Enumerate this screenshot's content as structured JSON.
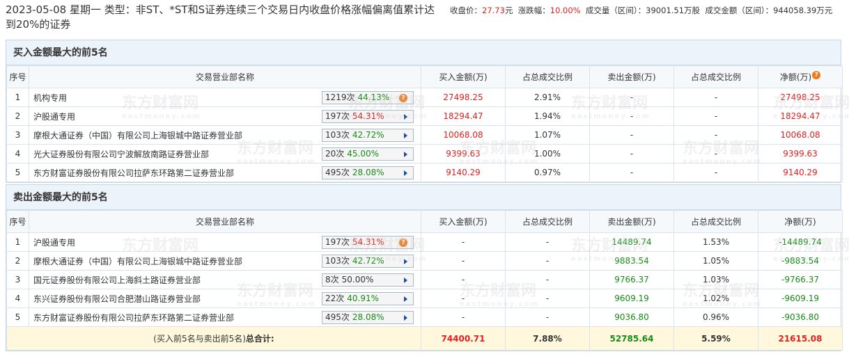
{
  "header": {
    "title": "2023-05-08 星期一 类型：非ST、*ST和S证券连续三个交易日内收盘价格涨幅偏离值累计达到20%的证券",
    "close_label": "收盘价：",
    "close_value": "27.73",
    "unit_yuan": "元",
    "change_label": "涨跌幅：",
    "change_value": "10.00%",
    "volume_label": "成交量（区间）：",
    "volume_value": "39001.51万股",
    "amount_label": "成交金额（区间）：",
    "amount_value": "944058.39万元"
  },
  "buy_section": {
    "title": "买入金额最大的前5名",
    "columns": [
      "序号",
      "交易营业部名称",
      "买入金额(万)",
      "占总成交比例",
      "卖出金额(万)",
      "占总成交比例",
      "净额(万)"
    ],
    "rows": [
      {
        "idx": "1",
        "name": "机构专用",
        "count": "1219次",
        "pct": "44.13%",
        "pct_color": "green",
        "icon": "question-icon",
        "buy": "27498.25",
        "buy_ratio": "2.91%",
        "sell": "-",
        "sell_ratio": "-",
        "net": "27498.25"
      },
      {
        "idx": "2",
        "name": "沪股通专用",
        "count": "197次",
        "pct": "54.31%",
        "pct_color": "red",
        "icon": "arrow-right-icon",
        "buy": "18294.47",
        "buy_ratio": "1.94%",
        "sell": "-",
        "sell_ratio": "-",
        "net": "18294.47"
      },
      {
        "idx": "3",
        "name": "摩根大通证券（中国）有限公司上海银城中路证券营业部",
        "count": "103次",
        "pct": "42.72%",
        "pct_color": "green",
        "icon": "arrow-right-icon",
        "buy": "10068.08",
        "buy_ratio": "1.07%",
        "sell": "-",
        "sell_ratio": "-",
        "net": "10068.08"
      },
      {
        "idx": "4",
        "name": "光大证券股份有限公司宁波解放南路证券营业部",
        "count": "20次",
        "pct": "45.00%",
        "pct_color": "green",
        "icon": "arrow-right-icon",
        "buy": "9399.63",
        "buy_ratio": "1.00%",
        "sell": "-",
        "sell_ratio": "-",
        "net": "9399.63"
      },
      {
        "idx": "5",
        "name": "东方财富证券股份有限公司拉萨东环路第二证券营业部",
        "count": "495次",
        "pct": "28.08%",
        "pct_color": "green",
        "icon": "arrow-right-icon",
        "buy": "9140.29",
        "buy_ratio": "0.97%",
        "sell": "-",
        "sell_ratio": "-",
        "net": "9140.29"
      }
    ]
  },
  "sell_section": {
    "title": "卖出金额最大的前5名",
    "columns": [
      "序号",
      "交易营业部名称",
      "买入金额(万)",
      "占总成交比例",
      "卖出金额(万)",
      "占总成交比例",
      "净额(万)"
    ],
    "rows": [
      {
        "idx": "1",
        "name": "沪股通专用",
        "count": "197次",
        "pct": "54.31%",
        "pct_color": "red",
        "icon": "question-icon",
        "buy": "-",
        "buy_ratio": "-",
        "sell": "14489.74",
        "sell_ratio": "1.53%",
        "net": "-14489.74"
      },
      {
        "idx": "2",
        "name": "摩根大通证券（中国）有限公司上海银城中路证券营业部",
        "count": "103次",
        "pct": "42.72%",
        "pct_color": "green",
        "icon": "arrow-right-icon",
        "buy": "-",
        "buy_ratio": "-",
        "sell": "9883.54",
        "sell_ratio": "1.05%",
        "net": "-9883.54"
      },
      {
        "idx": "3",
        "name": "国元证券股份有限公司上海斜土路证券营业部",
        "count": "8次",
        "pct": "50.00%",
        "pct_color": "plain",
        "icon": "arrow-right-icon",
        "buy": "-",
        "buy_ratio": "-",
        "sell": "9766.37",
        "sell_ratio": "1.03%",
        "net": "-9766.37"
      },
      {
        "idx": "4",
        "name": "东兴证券股份有限公司合肥潜山路证券营业部",
        "count": "22次",
        "pct": "40.91%",
        "pct_color": "green",
        "icon": "arrow-right-icon",
        "buy": "-",
        "buy_ratio": "-",
        "sell": "9609.19",
        "sell_ratio": "1.02%",
        "net": "-9609.19"
      },
      {
        "idx": "5",
        "name": "东方财富证券股份有限公司拉萨东环路第二证券营业部",
        "count": "495次",
        "pct": "28.08%",
        "pct_color": "green",
        "icon": "arrow-right-icon",
        "buy": "-",
        "buy_ratio": "-",
        "sell": "9036.80",
        "sell_ratio": "0.96%",
        "net": "-9036.80"
      }
    ]
  },
  "summary": {
    "label_prefix": "(买入前5名与卖出前5名)",
    "label_bold": "总合计:",
    "buy_total": "74400.71",
    "buy_ratio": "7.88%",
    "sell_total": "52785.64",
    "sell_ratio": "5.59%",
    "net_total": "21615.08"
  },
  "watermark": {
    "text": "东方财富网",
    "subtext": "eastmoney.com"
  },
  "colors": {
    "red": "#e02020",
    "green": "#178b17",
    "header_bg": "#edf3fa",
    "summary_bg": "#fff8dc",
    "question_icon": "#f07a1a",
    "arrow": "#1a4f9c"
  }
}
